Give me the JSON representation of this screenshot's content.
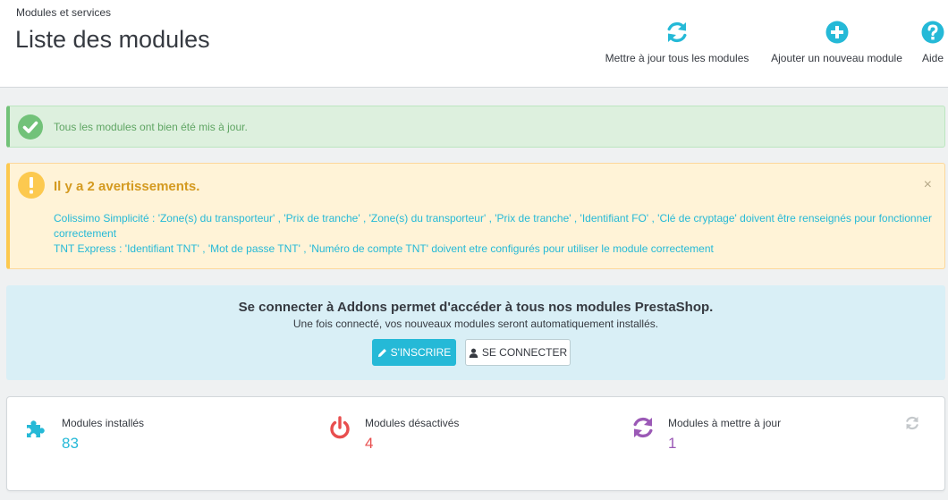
{
  "header": {
    "breadcrumb": "Modules et services",
    "title": "Liste des modules"
  },
  "toolbar": {
    "update_all": {
      "label": "Mettre à jour tous les modules",
      "icon": "refresh-icon"
    },
    "add_module": {
      "label": "Ajouter un nouveau module",
      "icon": "plus-circle-icon"
    },
    "help": {
      "label": "Aide",
      "icon": "question-circle-icon"
    }
  },
  "alerts": {
    "success": {
      "text": "Tous les modules ont bien été mis à jour."
    },
    "warning": {
      "title": "Il y a 2 avertissements.",
      "close": "×",
      "items": [
        "Colissimo Simplicité : 'Zone(s) du transporteur' , 'Prix de tranche' , 'Zone(s) du transporteur' , 'Prix de tranche' , 'Identifiant FO' , 'Clé de cryptage' doivent être renseignés pour fonctionner correctement",
        "TNT Express : 'Identifiant TNT' , 'Mot de passe TNT' , 'Numéro de compte TNT' doivent etre configurés pour utiliser le module correctement"
      ]
    }
  },
  "addons": {
    "title": "Se connecter à Addons permet d'accéder à tous nos modules PrestaShop.",
    "subtitle": "Une fois connecté, vos nouveaux modules seront automatiquement installés.",
    "signup_label": "S'INSCRIRE",
    "login_label": "SE CONNECTER"
  },
  "stats": {
    "installed": {
      "label": "Modules installés",
      "value": "83",
      "color": "#25b9d7"
    },
    "disabled": {
      "label": "Modules désactivés",
      "value": "4",
      "color": "#e84e4e"
    },
    "to_update": {
      "label": "Modules à mettre à jour",
      "value": "1",
      "color": "#9b59b6"
    }
  },
  "colors": {
    "primary": "#25b9d7",
    "success": "#72c279",
    "warning": "#fcc94f",
    "danger": "#e84e4e",
    "purple": "#9b59b6"
  }
}
